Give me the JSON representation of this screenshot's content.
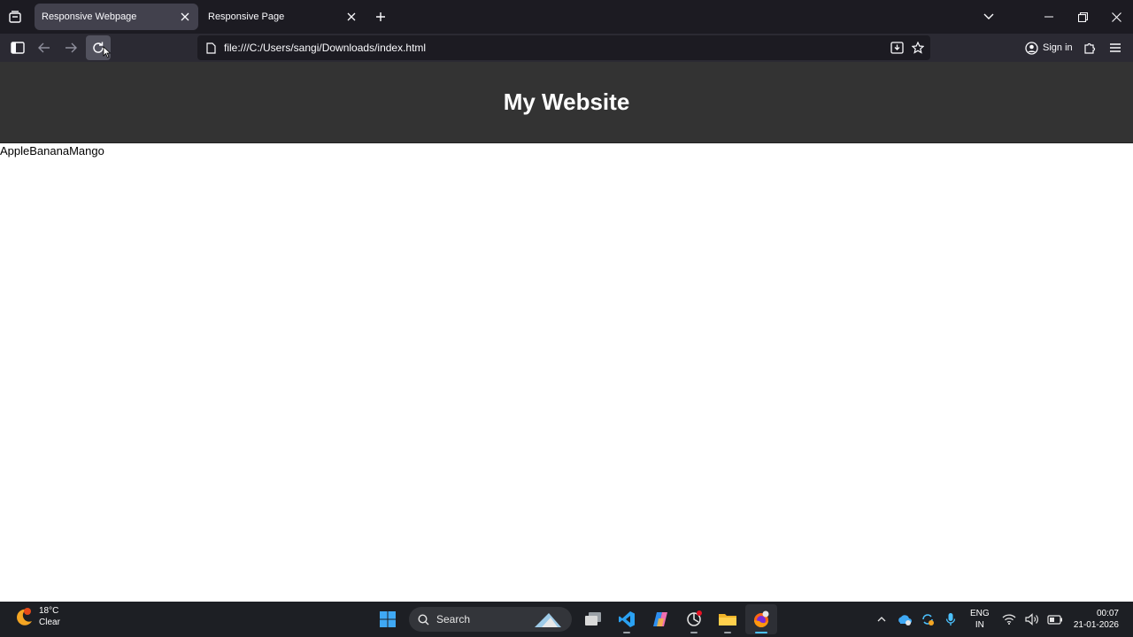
{
  "browser": {
    "tabs": [
      {
        "title": "Responsive Webpage",
        "active": true
      },
      {
        "title": "Responsive Page",
        "active": false
      }
    ],
    "url": "file:///C:/Users/sangi/Downloads/index.html",
    "sign_in_label": "Sign in"
  },
  "page": {
    "header_title": "My Website",
    "body_text": "AppleBananaMango"
  },
  "taskbar": {
    "weather": {
      "temperature": "18°C",
      "condition": "Clear"
    },
    "search_placeholder": "Search",
    "language": {
      "line1": "ENG",
      "line2": "IN"
    },
    "time": "00:07",
    "date": "21-01-2026"
  },
  "colors": {
    "browser_bg": "#1c1b22",
    "navbar_bg": "#2b2a33",
    "site_header_bg": "#333333",
    "taskbar_bg": "#1d1f24",
    "accent": "#4cc2ff"
  }
}
